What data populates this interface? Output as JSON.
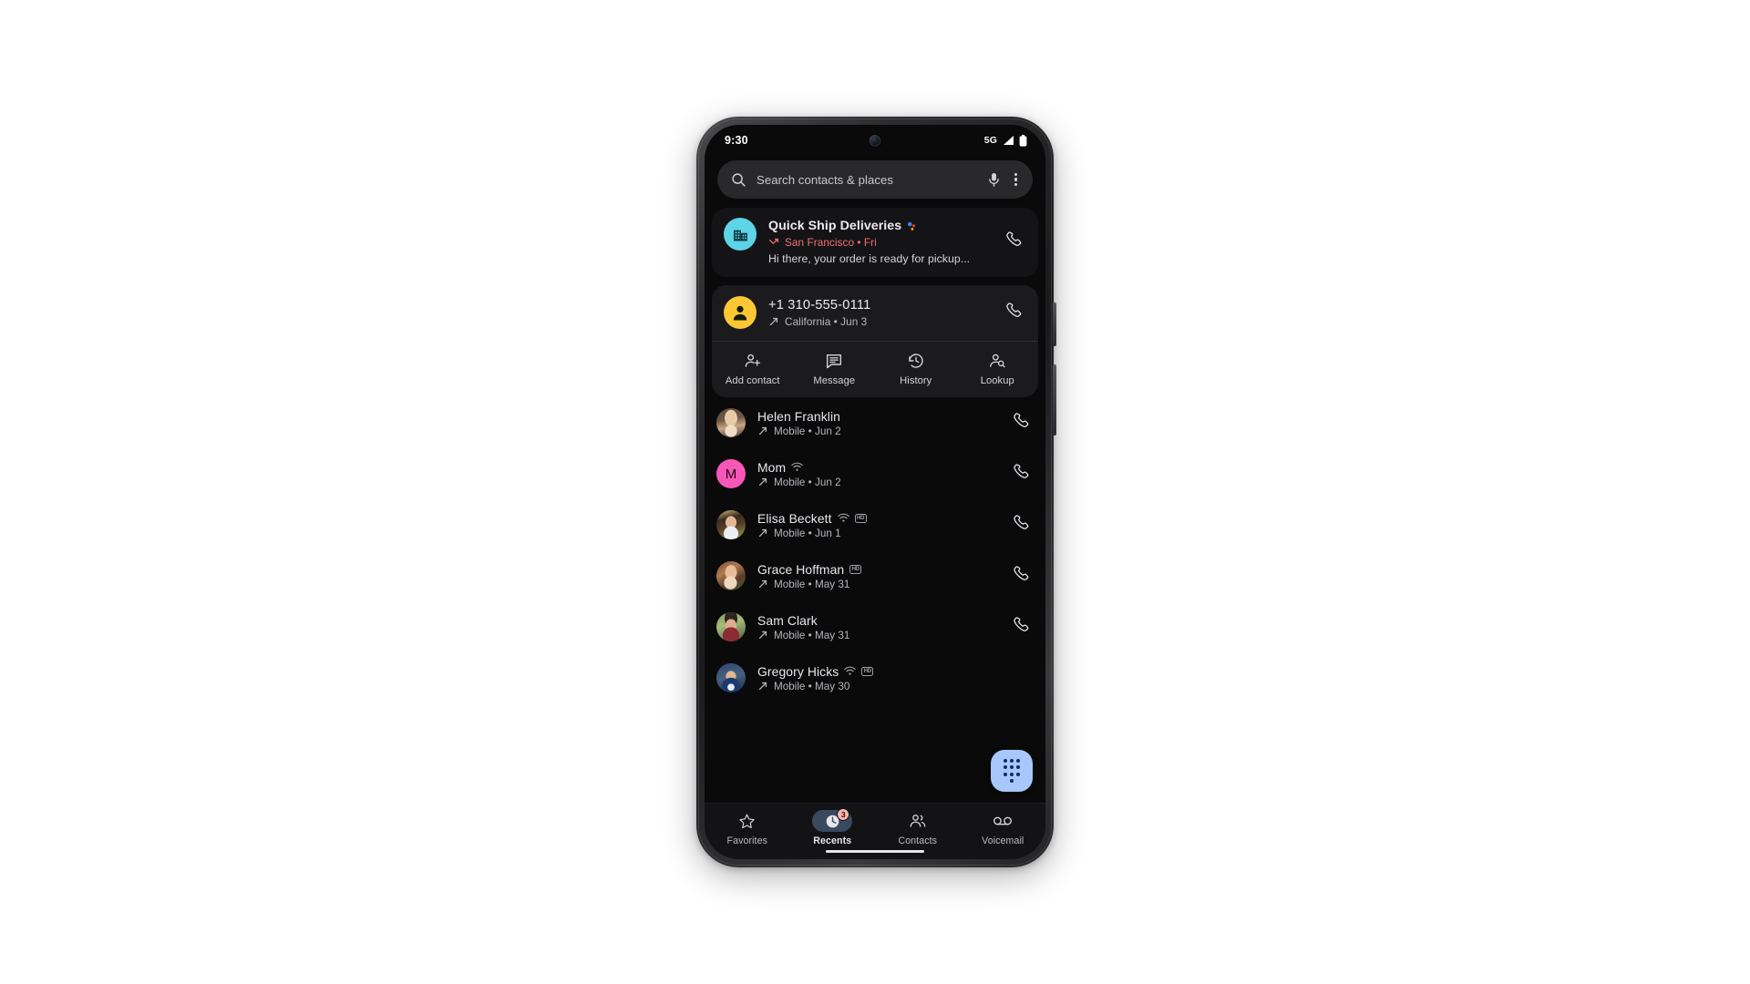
{
  "status_bar": {
    "time": "9:30",
    "network_label": "5G",
    "signal_icon": "cellular-signal-icon",
    "battery_icon": "battery-full-icon",
    "camera_icon": "front-camera-punch-hole"
  },
  "search": {
    "placeholder": "Search contacts & places",
    "search_icon": "search-icon",
    "mic_icon": "microphone-icon",
    "overflow_icon": "more-vert-icon"
  },
  "business_card": {
    "avatar_icon": "business-building-icon",
    "avatar_color": "#5ed4e8",
    "name": "Quick Ship Deliveries",
    "verified_icon": "google-verified-icon",
    "call_type_icon": "missed-incoming-call-icon",
    "location_date": "San Francisco • Fri",
    "spam_color": "#f2716e",
    "message_preview": "Hi there, your order is ready for pickup...",
    "call_icon": "phone-call-icon"
  },
  "expanded_card": {
    "avatar_icon": "person-avatar-icon",
    "avatar_color": "#fcc934",
    "number": "+1 310-555-0111",
    "call_type_icon": "outgoing-call-arrow-icon",
    "location_date": "California • Jun 3",
    "call_icon": "phone-call-icon",
    "actions": [
      {
        "label": "Add contact",
        "icon": "person-add-icon"
      },
      {
        "label": "Message",
        "icon": "message-bubble-icon"
      },
      {
        "label": "History",
        "icon": "history-clock-icon"
      },
      {
        "label": "Lookup",
        "icon": "person-search-icon"
      }
    ]
  },
  "call_log": [
    {
      "name": "Helen Franklin",
      "call_type_icon": "outgoing-call-arrow-icon",
      "detail": "Mobile • Jun 2",
      "avatar_type": "photo",
      "avatar_id": "helen-franklin-photo",
      "badges": [],
      "call_icon": "phone-call-icon"
    },
    {
      "name": "Mom",
      "call_type_icon": "outgoing-call-arrow-icon",
      "detail": "Mobile • Jun 2",
      "avatar_type": "initial",
      "avatar_initial": "M",
      "avatar_color": "#f857b7",
      "badges": [
        "wifi-calling-icon"
      ],
      "call_icon": "phone-call-icon"
    },
    {
      "name": "Elisa Beckett",
      "call_type_icon": "outgoing-call-arrow-icon",
      "detail": "Mobile • Jun 1",
      "avatar_type": "photo",
      "avatar_id": "elisa-beckett-photo",
      "badges": [
        "wifi-calling-icon",
        "hd-video-icon"
      ],
      "call_icon": "phone-call-icon"
    },
    {
      "name": "Grace Hoffman",
      "call_type_icon": "outgoing-call-arrow-icon",
      "detail": "Mobile • May 31",
      "avatar_type": "photo",
      "avatar_id": "grace-hoffman-photo",
      "badges": [
        "hd-video-icon"
      ],
      "call_icon": "phone-call-icon"
    },
    {
      "name": "Sam Clark",
      "call_type_icon": "outgoing-call-arrow-icon",
      "detail": "Mobile • May 31",
      "avatar_type": "photo",
      "avatar_id": "sam-clark-photo",
      "badges": [],
      "call_icon": "phone-call-icon"
    },
    {
      "name": "Gregory Hicks",
      "call_type_icon": "outgoing-call-arrow-icon",
      "detail": "Mobile • May 30",
      "avatar_type": "photo",
      "avatar_id": "gregory-hicks-photo",
      "badges": [
        "wifi-calling-icon",
        "hd-video-icon"
      ],
      "call_icon": "phone-call-icon"
    }
  ],
  "fab": {
    "icon": "dialpad-icon",
    "background": "#a8c7fa"
  },
  "bottom_nav": {
    "active_index": 1,
    "items": [
      {
        "label": "Favorites",
        "icon": "star-outline-icon",
        "badge": null
      },
      {
        "label": "Recents",
        "icon": "recents-clock-icon",
        "badge": "3"
      },
      {
        "label": "Contacts",
        "icon": "contacts-people-icon",
        "badge": null
      },
      {
        "label": "Voicemail",
        "icon": "voicemail-icon",
        "badge": null
      }
    ]
  }
}
